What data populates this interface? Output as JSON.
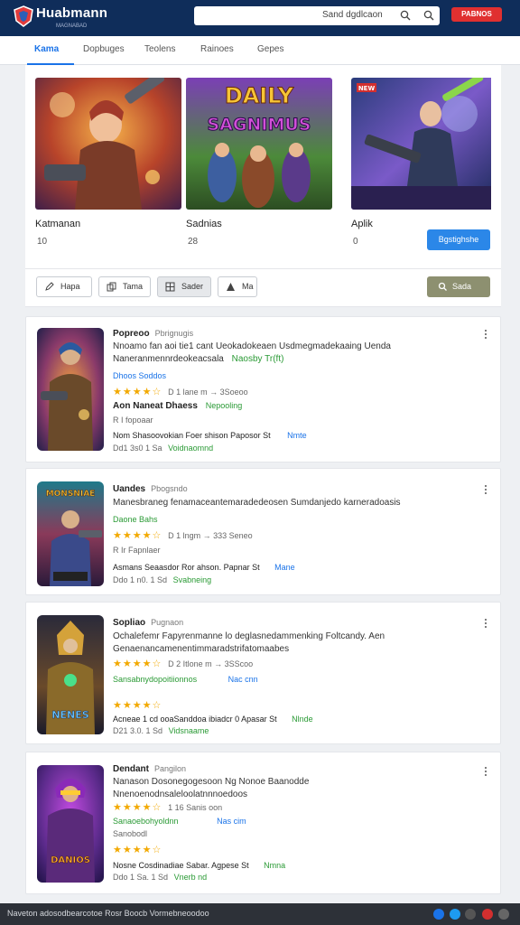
{
  "header": {
    "app_title": "Huabmann",
    "app_subtitle": "MAGNABAD",
    "search_text": "Sand dgdlcaon",
    "promo_label": "PABNOS"
  },
  "tabs": [
    {
      "label": "Kama"
    },
    {
      "label": "Dopbuges"
    },
    {
      "label": "Teolens"
    },
    {
      "label": "Rainoes"
    },
    {
      "label": "Gepes"
    }
  ],
  "featured": [
    {
      "name": "Katmanan",
      "number": "10",
      "icon": "hero-warrior-art"
    },
    {
      "name": "Sadnias",
      "number": "28",
      "icon": "daily-sagnimus-art",
      "image_text_1": "DAILY",
      "image_text_2": "SAGNIMUS"
    },
    {
      "name": "Aplik",
      "number": "0",
      "icon": "space-soldier-art",
      "badge": "NEW"
    }
  ],
  "featured_button": "Bgstighshe",
  "filters": [
    {
      "label": "Hapa",
      "icon": "pencil-icon"
    },
    {
      "label": "Tama",
      "icon": "copy-icon"
    },
    {
      "label": "Sader",
      "icon": "grid-icon"
    },
    {
      "label": "Ma",
      "icon": "triangle-icon"
    }
  ],
  "sort_label": "Sada",
  "listings": [
    {
      "title": "Popreoo",
      "subtitle": "Pbrignugis",
      "desc1": "Nnoamo fan aoi tie1 cant Ueokadokeaen Usdmegmadekaaing Uenda",
      "desc2a": "Naneranmennrdeokeacsala",
      "desc2b": "Naosby Tr(ft)",
      "tag": "Dhoos Soddos",
      "stars": "★★★★☆",
      "meta": "D 1 lane m  →  3Soeoo",
      "line5a": "Aon Naneat Dhaess",
      "line5b": "Nepooling",
      "line6": "R I fopoaar",
      "line7a": "Nom Shasoovokian Foer shison Paposor St",
      "line7b": "Nmte",
      "line8a": "Dd1 3s0 1 Sa",
      "line8b": "Voidnaomnd"
    },
    {
      "title": "Uandes",
      "subtitle": "Pbogsndo",
      "desc1": "Manesbraneg  fenamaceantemaradedeosen  Sumdanjedo karneradoasis",
      "tag": "Daone Bahs",
      "stars": "★★★★☆",
      "meta": "D 1 lngm  →  333 Seneo",
      "line6": "R  Ir Fapnlaer",
      "line7a": "Asmans Seaasdor Ror ahson. Papnar St",
      "line7b": "Mane",
      "line8a": "Ddo 1 n0. 1 Sd",
      "line8b": "Svabneing",
      "thumb_text": "MONSNIAE"
    },
    {
      "title": "Sopliao",
      "subtitle": "Pugnaon",
      "desc1": "Ochalefemr  Fapyrenmanne lo deglasnedammenking  Foltcandy. Aen",
      "desc2a": "Genaenancamenentimmaradstrifatomaabes",
      "tag": "Sansabnydopoitiionnos",
      "tag_b": "Nac cnn",
      "stars": "★★★★☆",
      "meta": "D 2 Itlone m  →  3SScoo",
      "stars2": "★★★★☆",
      "line7a": "Acneae 1 cd ooaSanddoa ibiadcr  0 Apasar St",
      "line7b": "Nlnde",
      "line8a": "D21 3.0. 1 Sd",
      "line8b": "Vidsnaame",
      "thumb_text": "NENES"
    },
    {
      "title": "Dendant",
      "subtitle": "Pangilon",
      "desc1": "Nanason Dosonegogesoon Ng Nonoe Baanodde",
      "desc2a": "Nnenoenodnsaleloolatnnnoedoos",
      "meta2": "1 16  Sanis oon",
      "tag": "Sanaoebohyoldnn",
      "tag_b": "Nas cim",
      "tag2": "Sanobodl",
      "stars": "★★★★☆",
      "line7a": "Nosne Cosdinadiae Sabar.  Agpese St",
      "line7b": "Nmna",
      "line8a": "Ddo 1 Sa. 1 Sd",
      "line8b": "Vnerb nd",
      "thumb_text": "DANIOS"
    }
  ],
  "footer": {
    "text": "Naveton adosodbearcotoe  Rosr Boocb Vormebneoodoo"
  },
  "colors": {
    "header_bg": "#0f2d5a",
    "accent_blue": "#2b87e8",
    "promo_red": "#e03030",
    "star_gold": "#f2a900",
    "green": "#2a9a35"
  }
}
